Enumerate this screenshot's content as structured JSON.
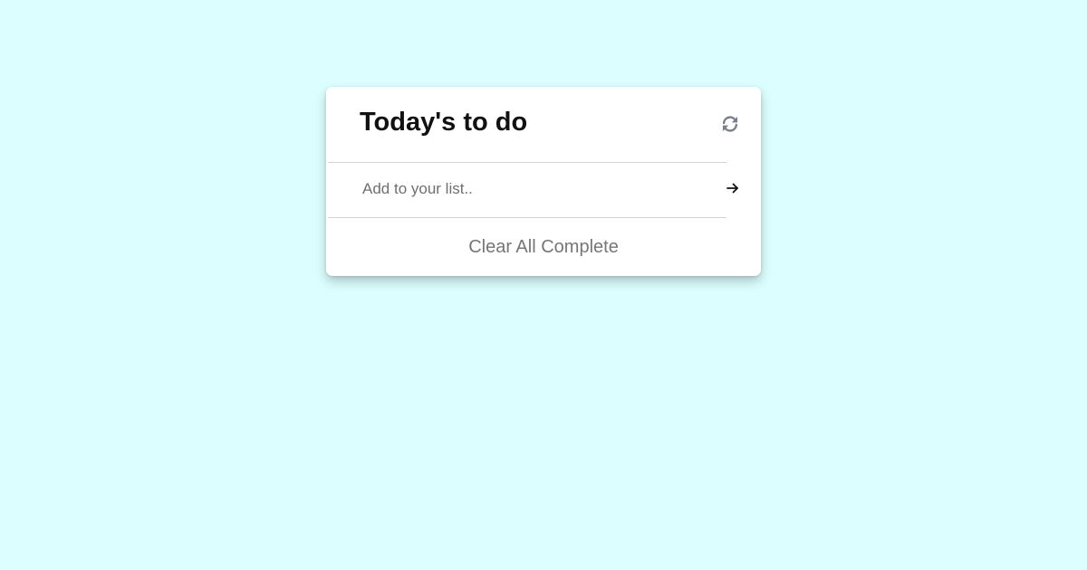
{
  "page": {
    "background_color": "#dcfefe"
  },
  "todo": {
    "title": "Today's to do",
    "refresh_icon": "refresh-icon",
    "input": {
      "value": "",
      "placeholder": "Add to your list.."
    },
    "submit_icon": "arrow-right-icon",
    "clear_label": "Clear All Complete"
  },
  "colors": {
    "card": "#ffffff",
    "title_text": "#111111",
    "icon_gray": "#7a7f87",
    "muted_text": "#767676",
    "divider": "#cfd2d6"
  }
}
